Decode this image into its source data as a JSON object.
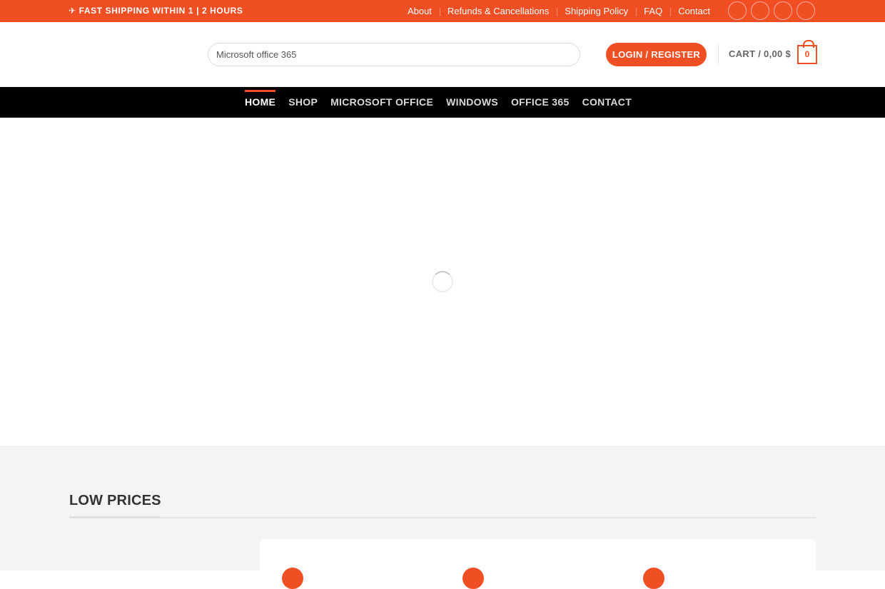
{
  "topbar": {
    "promo": "✈ FAST SHIPPING WITHIN 1 | 2 HOURS",
    "nav": [
      "About",
      "Refunds & Cancellations",
      "Shipping Policy",
      "FAQ",
      "Contact"
    ]
  },
  "header": {
    "search_value": "Microsoft office 365",
    "login_label": "LOGIN / REGISTER",
    "cart_label": "CART / ",
    "cart_total": "0,00 $",
    "cart_count": "0"
  },
  "mainnav": {
    "items": [
      "HOME",
      "SHOP",
      "MICROSOFT OFFICE",
      "WINDOWS",
      "OFFICE 365",
      "CONTACT"
    ]
  },
  "section": {
    "title": "LOW PRICES"
  },
  "colors": {
    "accent": "#f04e23",
    "nav_bg": "#000000",
    "section_bg": "#f4f4f4"
  }
}
